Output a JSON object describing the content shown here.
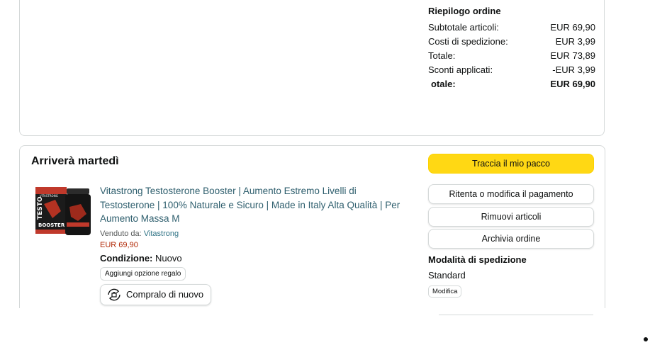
{
  "summary": {
    "title": "Riepilogo ordine",
    "rows": [
      {
        "label": "Subtotale articoli:",
        "value": "EUR 69,90"
      },
      {
        "label": "Costi di spedizione:",
        "value": "EUR 3,99"
      },
      {
        "label": "Totale:",
        "value": "EUR 73,89"
      },
      {
        "label": "Sconti applicati:",
        "value": "-EUR 3,99"
      }
    ],
    "grand_total_label": "otale:",
    "grand_total_value": "EUR 69,90"
  },
  "shipment": {
    "heading": "Arriverà martedì"
  },
  "product": {
    "title": "Vitastrong Testosterone Booster | Aumento Estremo Livelli di Testosterone | 100% Naturale e Sicuro | Made in Italy Alta Qualità | Per Aumento Massa M",
    "sold_by_label": "Venduto da: ",
    "seller": "Vitastrong",
    "price": "EUR 69,90",
    "condition_label": "Condizione:",
    "condition_value": " Nuovo",
    "gift_button": "Aggiungi opzione regalo",
    "buy_again_button": "Compralo di nuovo",
    "image_text_1": "TESTO",
    "image_text_2": "BOOSTER"
  },
  "actions": {
    "track": "Traccia il mio pacco",
    "retry_payment": "Ritenta o modifica il pagamento",
    "remove_items": "Rimuovi articoli",
    "archive": "Archivia ordine"
  },
  "shipping_method": {
    "heading": "Modalità di spedizione",
    "value": "Standard",
    "edit_button": "Modifica"
  },
  "colors": {
    "primary_button": "#ffd814",
    "link": "#2f5f6e",
    "price": "#b12704"
  }
}
